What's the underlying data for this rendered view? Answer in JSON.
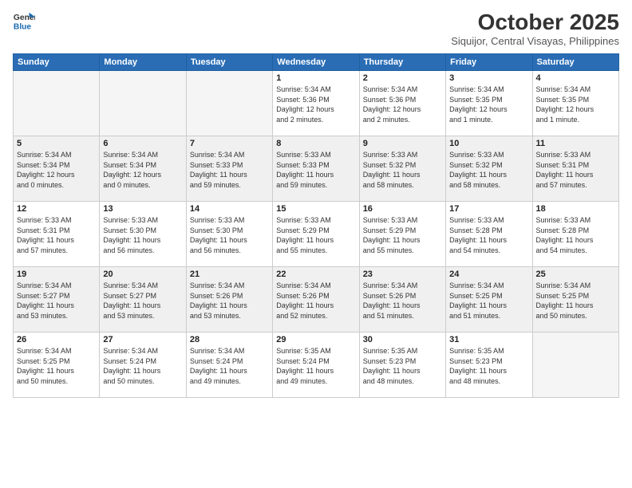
{
  "header": {
    "logo_line1": "General",
    "logo_line2": "Blue",
    "month": "October 2025",
    "location": "Siquijor, Central Visayas, Philippines"
  },
  "weekdays": [
    "Sunday",
    "Monday",
    "Tuesday",
    "Wednesday",
    "Thursday",
    "Friday",
    "Saturday"
  ],
  "weeks": [
    [
      {
        "day": "",
        "info": ""
      },
      {
        "day": "",
        "info": ""
      },
      {
        "day": "",
        "info": ""
      },
      {
        "day": "1",
        "info": "Sunrise: 5:34 AM\nSunset: 5:36 PM\nDaylight: 12 hours\nand 2 minutes."
      },
      {
        "day": "2",
        "info": "Sunrise: 5:34 AM\nSunset: 5:36 PM\nDaylight: 12 hours\nand 2 minutes."
      },
      {
        "day": "3",
        "info": "Sunrise: 5:34 AM\nSunset: 5:35 PM\nDaylight: 12 hours\nand 1 minute."
      },
      {
        "day": "4",
        "info": "Sunrise: 5:34 AM\nSunset: 5:35 PM\nDaylight: 12 hours\nand 1 minute."
      }
    ],
    [
      {
        "day": "5",
        "info": "Sunrise: 5:34 AM\nSunset: 5:34 PM\nDaylight: 12 hours\nand 0 minutes."
      },
      {
        "day": "6",
        "info": "Sunrise: 5:34 AM\nSunset: 5:34 PM\nDaylight: 12 hours\nand 0 minutes."
      },
      {
        "day": "7",
        "info": "Sunrise: 5:34 AM\nSunset: 5:33 PM\nDaylight: 11 hours\nand 59 minutes."
      },
      {
        "day": "8",
        "info": "Sunrise: 5:33 AM\nSunset: 5:33 PM\nDaylight: 11 hours\nand 59 minutes."
      },
      {
        "day": "9",
        "info": "Sunrise: 5:33 AM\nSunset: 5:32 PM\nDaylight: 11 hours\nand 58 minutes."
      },
      {
        "day": "10",
        "info": "Sunrise: 5:33 AM\nSunset: 5:32 PM\nDaylight: 11 hours\nand 58 minutes."
      },
      {
        "day": "11",
        "info": "Sunrise: 5:33 AM\nSunset: 5:31 PM\nDaylight: 11 hours\nand 57 minutes."
      }
    ],
    [
      {
        "day": "12",
        "info": "Sunrise: 5:33 AM\nSunset: 5:31 PM\nDaylight: 11 hours\nand 57 minutes."
      },
      {
        "day": "13",
        "info": "Sunrise: 5:33 AM\nSunset: 5:30 PM\nDaylight: 11 hours\nand 56 minutes."
      },
      {
        "day": "14",
        "info": "Sunrise: 5:33 AM\nSunset: 5:30 PM\nDaylight: 11 hours\nand 56 minutes."
      },
      {
        "day": "15",
        "info": "Sunrise: 5:33 AM\nSunset: 5:29 PM\nDaylight: 11 hours\nand 55 minutes."
      },
      {
        "day": "16",
        "info": "Sunrise: 5:33 AM\nSunset: 5:29 PM\nDaylight: 11 hours\nand 55 minutes."
      },
      {
        "day": "17",
        "info": "Sunrise: 5:33 AM\nSunset: 5:28 PM\nDaylight: 11 hours\nand 54 minutes."
      },
      {
        "day": "18",
        "info": "Sunrise: 5:33 AM\nSunset: 5:28 PM\nDaylight: 11 hours\nand 54 minutes."
      }
    ],
    [
      {
        "day": "19",
        "info": "Sunrise: 5:34 AM\nSunset: 5:27 PM\nDaylight: 11 hours\nand 53 minutes."
      },
      {
        "day": "20",
        "info": "Sunrise: 5:34 AM\nSunset: 5:27 PM\nDaylight: 11 hours\nand 53 minutes."
      },
      {
        "day": "21",
        "info": "Sunrise: 5:34 AM\nSunset: 5:26 PM\nDaylight: 11 hours\nand 53 minutes."
      },
      {
        "day": "22",
        "info": "Sunrise: 5:34 AM\nSunset: 5:26 PM\nDaylight: 11 hours\nand 52 minutes."
      },
      {
        "day": "23",
        "info": "Sunrise: 5:34 AM\nSunset: 5:26 PM\nDaylight: 11 hours\nand 51 minutes."
      },
      {
        "day": "24",
        "info": "Sunrise: 5:34 AM\nSunset: 5:25 PM\nDaylight: 11 hours\nand 51 minutes."
      },
      {
        "day": "25",
        "info": "Sunrise: 5:34 AM\nSunset: 5:25 PM\nDaylight: 11 hours\nand 50 minutes."
      }
    ],
    [
      {
        "day": "26",
        "info": "Sunrise: 5:34 AM\nSunset: 5:25 PM\nDaylight: 11 hours\nand 50 minutes."
      },
      {
        "day": "27",
        "info": "Sunrise: 5:34 AM\nSunset: 5:24 PM\nDaylight: 11 hours\nand 50 minutes."
      },
      {
        "day": "28",
        "info": "Sunrise: 5:34 AM\nSunset: 5:24 PM\nDaylight: 11 hours\nand 49 minutes."
      },
      {
        "day": "29",
        "info": "Sunrise: 5:35 AM\nSunset: 5:24 PM\nDaylight: 11 hours\nand 49 minutes."
      },
      {
        "day": "30",
        "info": "Sunrise: 5:35 AM\nSunset: 5:23 PM\nDaylight: 11 hours\nand 48 minutes."
      },
      {
        "day": "31",
        "info": "Sunrise: 5:35 AM\nSunset: 5:23 PM\nDaylight: 11 hours\nand 48 minutes."
      },
      {
        "day": "",
        "info": ""
      }
    ]
  ]
}
